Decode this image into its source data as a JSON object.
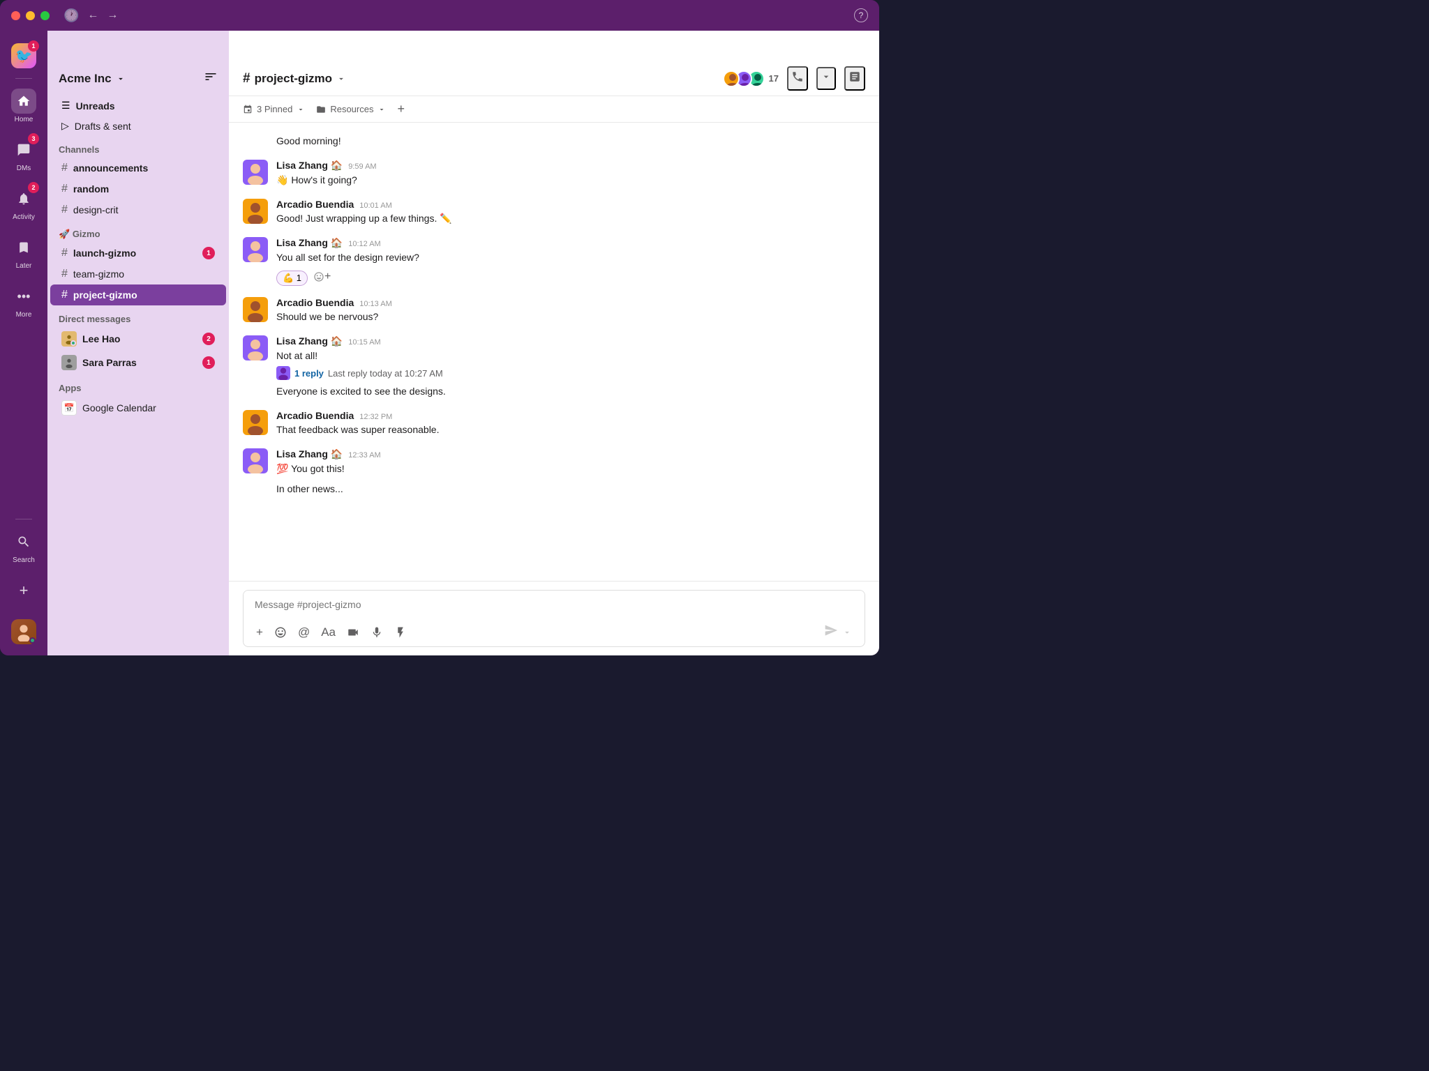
{
  "titlebar": {
    "nav_back": "←",
    "nav_forward": "→",
    "help_icon": "?"
  },
  "rail": {
    "workspace_emoji": "🐦",
    "workspace_badge": "1",
    "home_label": "Home",
    "dms_label": "DMs",
    "dms_badge": "3",
    "activity_label": "Activity",
    "activity_badge": "2",
    "later_label": "Later",
    "more_label": "More",
    "search_label": "Search",
    "add_label": "+"
  },
  "sidebar": {
    "workspace_name": "Acme Inc",
    "unreads_label": "Unreads",
    "drafts_label": "Drafts & sent",
    "channels_label": "Channels",
    "channels": [
      {
        "name": "announcements",
        "bold": true
      },
      {
        "name": "random",
        "bold": true
      },
      {
        "name": "design-crit",
        "bold": false
      }
    ],
    "group_label": "Gizmo",
    "group_emoji": "🚀",
    "group_channels": [
      {
        "name": "launch-gizmo",
        "badge": "1",
        "bold": true
      },
      {
        "name": "team-gizmo",
        "badge": "",
        "bold": false
      },
      {
        "name": "project-gizmo",
        "badge": "",
        "bold": false,
        "active": true
      }
    ],
    "dm_label": "Direct messages",
    "dms": [
      {
        "name": "Lee Hao",
        "badge": "2"
      },
      {
        "name": "Sara Parras",
        "badge": "1"
      }
    ],
    "apps_label": "Apps",
    "apps": [
      {
        "name": "Google Calendar"
      }
    ]
  },
  "chat": {
    "channel_name": "project-gizmo",
    "member_count": "17",
    "pinned_label": "3 Pinned",
    "resources_label": "Resources",
    "messages": [
      {
        "id": 1,
        "author": "Good morning!",
        "author_name": "",
        "time": "",
        "text": "Good morning!",
        "avatar_type": "arcadio"
      },
      {
        "id": 2,
        "author_name": "Lisa Zhang 🏠",
        "time": "9:59 AM",
        "text": "👋 How's it going?",
        "avatar_type": "lisa"
      },
      {
        "id": 3,
        "author_name": "Arcadio Buendia",
        "time": "10:01 AM",
        "text": "Good! Just wrapping up a few things. ✏️",
        "avatar_type": "arcadio"
      },
      {
        "id": 4,
        "author_name": "Lisa Zhang 🏠",
        "time": "10:12 AM",
        "text": "You all set for the design review?",
        "avatar_type": "lisa",
        "reaction": "💪 1"
      },
      {
        "id": 5,
        "author_name": "Arcadio Buendia",
        "time": "10:13 AM",
        "text": "Should we be nervous?",
        "avatar_type": "arcadio"
      },
      {
        "id": 6,
        "author_name": "Lisa Zhang 🏠",
        "time": "10:15 AM",
        "text": "Not at all!",
        "avatar_type": "lisa",
        "has_reply": true,
        "reply_count": "1 reply",
        "reply_time": "Last reply today at 10:27 AM",
        "extra_text": "Everyone is excited to see the designs."
      },
      {
        "id": 7,
        "author_name": "Arcadio Buendia",
        "time": "12:32 PM",
        "text": "That feedback was super reasonable.",
        "avatar_type": "arcadio"
      },
      {
        "id": 8,
        "author_name": "Lisa Zhang 🏠",
        "time": "12:33 AM",
        "text": "💯 You got this!",
        "avatar_type": "lisa",
        "extra_text": "In other news..."
      }
    ],
    "message_placeholder": "Message #project-gizmo"
  }
}
